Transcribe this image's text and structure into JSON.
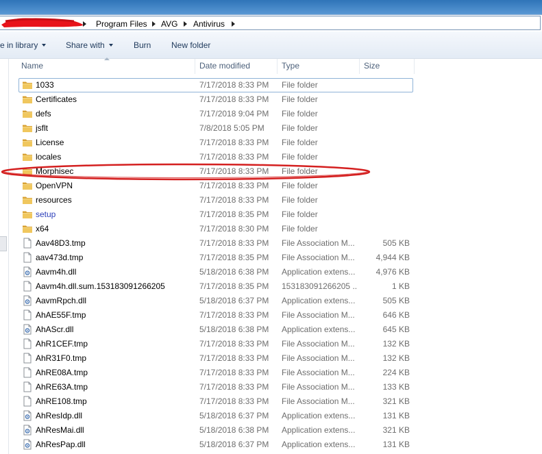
{
  "address": {
    "crumbs": [
      "Program Files",
      "AVG",
      "Antivirus"
    ]
  },
  "toolbar": {
    "include_library": "e in library",
    "share_with": "Share with",
    "burn": "Burn",
    "new_folder": "New folder"
  },
  "columns": {
    "name": "Name",
    "date": "Date modified",
    "type": "Type",
    "size": "Size"
  },
  "files": [
    {
      "name": "1033",
      "date": "7/17/2018 8:33 PM",
      "type": "File folder",
      "size": "",
      "icon": "folder-icon"
    },
    {
      "name": "Certificates",
      "date": "7/17/2018 8:33 PM",
      "type": "File folder",
      "size": "",
      "icon": "folder-icon"
    },
    {
      "name": "defs",
      "date": "7/17/2018 9:04 PM",
      "type": "File folder",
      "size": "",
      "icon": "folder-icon"
    },
    {
      "name": "jsflt",
      "date": "7/8/2018 5:05 PM",
      "type": "File folder",
      "size": "",
      "icon": "folder-icon"
    },
    {
      "name": "License",
      "date": "7/17/2018 8:33 PM",
      "type": "File folder",
      "size": "",
      "icon": "folder-icon"
    },
    {
      "name": "locales",
      "date": "7/17/2018 8:33 PM",
      "type": "File folder",
      "size": "",
      "icon": "folder-icon"
    },
    {
      "name": "Morphisec",
      "date": "7/17/2018 8:33 PM",
      "type": "File folder",
      "size": "",
      "icon": "folder-icon"
    },
    {
      "name": "OpenVPN",
      "date": "7/17/2018 8:33 PM",
      "type": "File folder",
      "size": "",
      "icon": "folder-icon"
    },
    {
      "name": "resources",
      "date": "7/17/2018 8:33 PM",
      "type": "File folder",
      "size": "",
      "icon": "folder-icon"
    },
    {
      "name": "setup",
      "date": "7/17/2018 8:35 PM",
      "type": "File folder",
      "size": "",
      "icon": "folder-icon"
    },
    {
      "name": "x64",
      "date": "7/17/2018 8:30 PM",
      "type": "File folder",
      "size": "",
      "icon": "folder-icon"
    },
    {
      "name": "Aav48D3.tmp",
      "date": "7/17/2018 8:33 PM",
      "type": "File Association M...",
      "size": "505 KB",
      "icon": "file-icon"
    },
    {
      "name": "aav473d.tmp",
      "date": "7/17/2018 8:35 PM",
      "type": "File Association M...",
      "size": "4,944 KB",
      "icon": "file-icon"
    },
    {
      "name": "Aavm4h.dll",
      "date": "5/18/2018 6:38 PM",
      "type": "Application extens...",
      "size": "4,976 KB",
      "icon": "dll-icon"
    },
    {
      "name": "Aavm4h.dll.sum.153183091266205",
      "date": "7/17/2018 8:35 PM",
      "type": "153183091266205 ...",
      "size": "1 KB",
      "icon": "file-icon"
    },
    {
      "name": "AavmRpch.dll",
      "date": "5/18/2018 6:37 PM",
      "type": "Application extens...",
      "size": "505 KB",
      "icon": "dll-icon"
    },
    {
      "name": "AhAE55F.tmp",
      "date": "7/17/2018 8:33 PM",
      "type": "File Association M...",
      "size": "646 KB",
      "icon": "file-icon"
    },
    {
      "name": "AhAScr.dll",
      "date": "5/18/2018 6:38 PM",
      "type": "Application extens...",
      "size": "645 KB",
      "icon": "dll-icon"
    },
    {
      "name": "AhR1CEF.tmp",
      "date": "7/17/2018 8:33 PM",
      "type": "File Association M...",
      "size": "132 KB",
      "icon": "file-icon"
    },
    {
      "name": "AhR31F0.tmp",
      "date": "7/17/2018 8:33 PM",
      "type": "File Association M...",
      "size": "132 KB",
      "icon": "file-icon"
    },
    {
      "name": "AhRE08A.tmp",
      "date": "7/17/2018 8:33 PM",
      "type": "File Association M...",
      "size": "224 KB",
      "icon": "file-icon"
    },
    {
      "name": "AhRE63A.tmp",
      "date": "7/17/2018 8:33 PM",
      "type": "File Association M...",
      "size": "133 KB",
      "icon": "file-icon"
    },
    {
      "name": "AhRE108.tmp",
      "date": "7/17/2018 8:33 PM",
      "type": "File Association M...",
      "size": "321 KB",
      "icon": "file-icon"
    },
    {
      "name": "AhResIdp.dll",
      "date": "5/18/2018 6:37 PM",
      "type": "Application extens...",
      "size": "131 KB",
      "icon": "dll-icon"
    },
    {
      "name": "AhResMai.dll",
      "date": "5/18/2018 6:38 PM",
      "type": "Application extens...",
      "size": "321 KB",
      "icon": "dll-icon"
    },
    {
      "name": "AhResPap.dll",
      "date": "5/18/2018 6:37 PM",
      "type": "Application extens...",
      "size": "131 KB",
      "icon": "dll-icon"
    }
  ],
  "focused_item": "1033",
  "highlighted_item": "Morphisec",
  "link_colored_item": "setup",
  "colors": {
    "highlight_ellipse": "#d42020",
    "redaction": "#e8131b",
    "folder": "#e8b94a",
    "header_text": "#4c607a",
    "toolbar_text": "#1e395b",
    "detail_text": "#6d6d6d"
  }
}
